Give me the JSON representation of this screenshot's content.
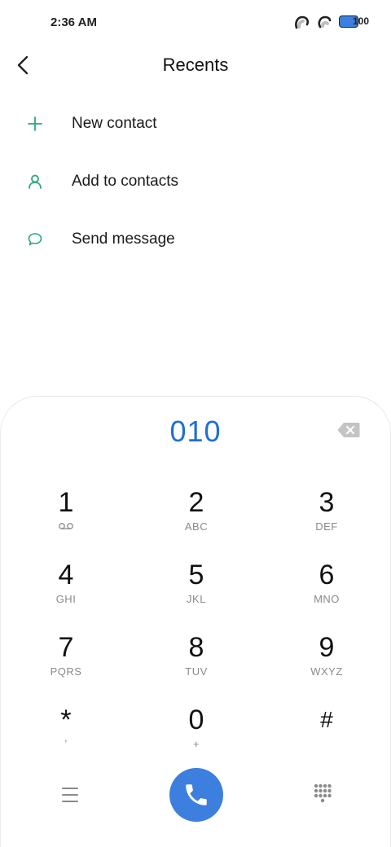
{
  "status_bar": {
    "time": "2:36 AM",
    "icons": [
      "sim-1-icon",
      "sim-2-icon",
      "battery-icon"
    ],
    "battery": "100",
    "battery_color": "#3c7fde"
  },
  "header": {
    "title": "Recents",
    "back_icon": "chevron-left-icon"
  },
  "actions": [
    {
      "label": "New contact",
      "icon": "plus-icon",
      "icon_color": "#2aa876"
    },
    {
      "label": "Add to contacts",
      "icon": "person-icon",
      "icon_color": "#2aa876"
    },
    {
      "label": "Send message",
      "icon": "message-bubble-icon",
      "icon_color": "#2aa876"
    }
  ],
  "dialpad": {
    "number": "010",
    "number_color": "#1f6fd6",
    "keys": [
      {
        "digit": "1",
        "letters": "",
        "sub_icon": "voicemail-icon"
      },
      {
        "digit": "2",
        "letters": "ABC"
      },
      {
        "digit": "3",
        "letters": "DEF"
      },
      {
        "digit": "4",
        "letters": "GHI"
      },
      {
        "digit": "5",
        "letters": "JKL"
      },
      {
        "digit": "6",
        "letters": "MNO"
      },
      {
        "digit": "7",
        "letters": "PQRS"
      },
      {
        "digit": "8",
        "letters": "TUV"
      },
      {
        "digit": "9",
        "letters": "WXYZ"
      },
      {
        "digit": "*",
        "letters": ","
      },
      {
        "digit": "0",
        "letters": "+"
      },
      {
        "digit": "#",
        "letters": ""
      }
    ],
    "call_button_color": "#3c7fde"
  }
}
